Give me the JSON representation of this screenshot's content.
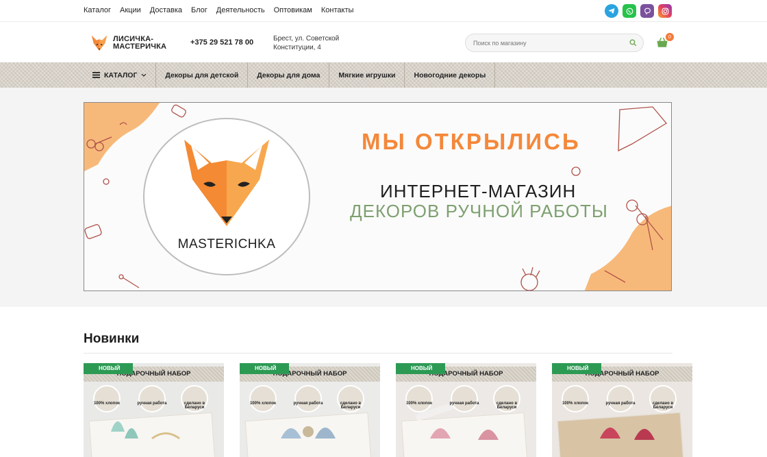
{
  "topnav": [
    "Каталог",
    "Акции",
    "Доставка",
    "Блог",
    "Деятельность",
    "Оптовикам",
    "Контакты"
  ],
  "socials": [
    {
      "name": "telegram-icon",
      "color": "#2aa3df"
    },
    {
      "name": "whatsapp-icon",
      "color": "#27c24c"
    },
    {
      "name": "viber-icon",
      "color": "#7b519d"
    },
    {
      "name": "instagram-icon",
      "color": "#e4405f"
    }
  ],
  "header": {
    "logo_line1": "ЛИСИЧКА-",
    "logo_line2": "МАСТЕРИЧКА",
    "phone": "+375 29 521 78 00",
    "address_line1": "Брест, ул. Советской",
    "address_line2": "Конституции, 4",
    "search_placeholder": "Поиск по магазину",
    "cart_count": "0"
  },
  "catbar": {
    "catalog_label": "КАТАЛОГ",
    "items": [
      "Декоры для детской",
      "Декоры для дома",
      "Мягкие игрушки",
      "Новогодние декоры"
    ]
  },
  "banner": {
    "brand": "MASTERICHKA",
    "title": "МЫ ОТКРЫЛИСЬ",
    "line1": "ИНТЕРНЕТ-МАГАЗИН",
    "line2": "ДЕКОРОВ РУЧНОЙ РАБОТЫ"
  },
  "section": {
    "title": "Новинки"
  },
  "products": [
    {
      "badge": "НОВЫЙ",
      "heading": "ПОДАРОЧНЫЙ НАБОР",
      "f1": "100% хлопок",
      "f2": "ручная работа",
      "f3": "сделано в Беларуси"
    },
    {
      "badge": "НОВЫЙ",
      "heading": "ПОДАРОЧНЫЙ НАБОР",
      "f1": "100% хлопок",
      "f2": "ручная работа",
      "f3": "сделано в Беларуси"
    },
    {
      "badge": "НОВЫЙ",
      "heading": "ПОДАРОЧНЫЙ НАБОР",
      "f1": "100% хлопок",
      "f2": "ручная работа",
      "f3": "сделано в Беларуси"
    },
    {
      "badge": "НОВЫЙ",
      "heading": "ПОДАРОЧНЫЙ НАБОР",
      "f1": "100% хлопок",
      "f2": "ручная работа",
      "f3": "сделано в Беларуси"
    }
  ],
  "colors": {
    "accent_orange": "#f4883a",
    "accent_green": "#7ea070",
    "new_badge": "#2d9a54"
  }
}
